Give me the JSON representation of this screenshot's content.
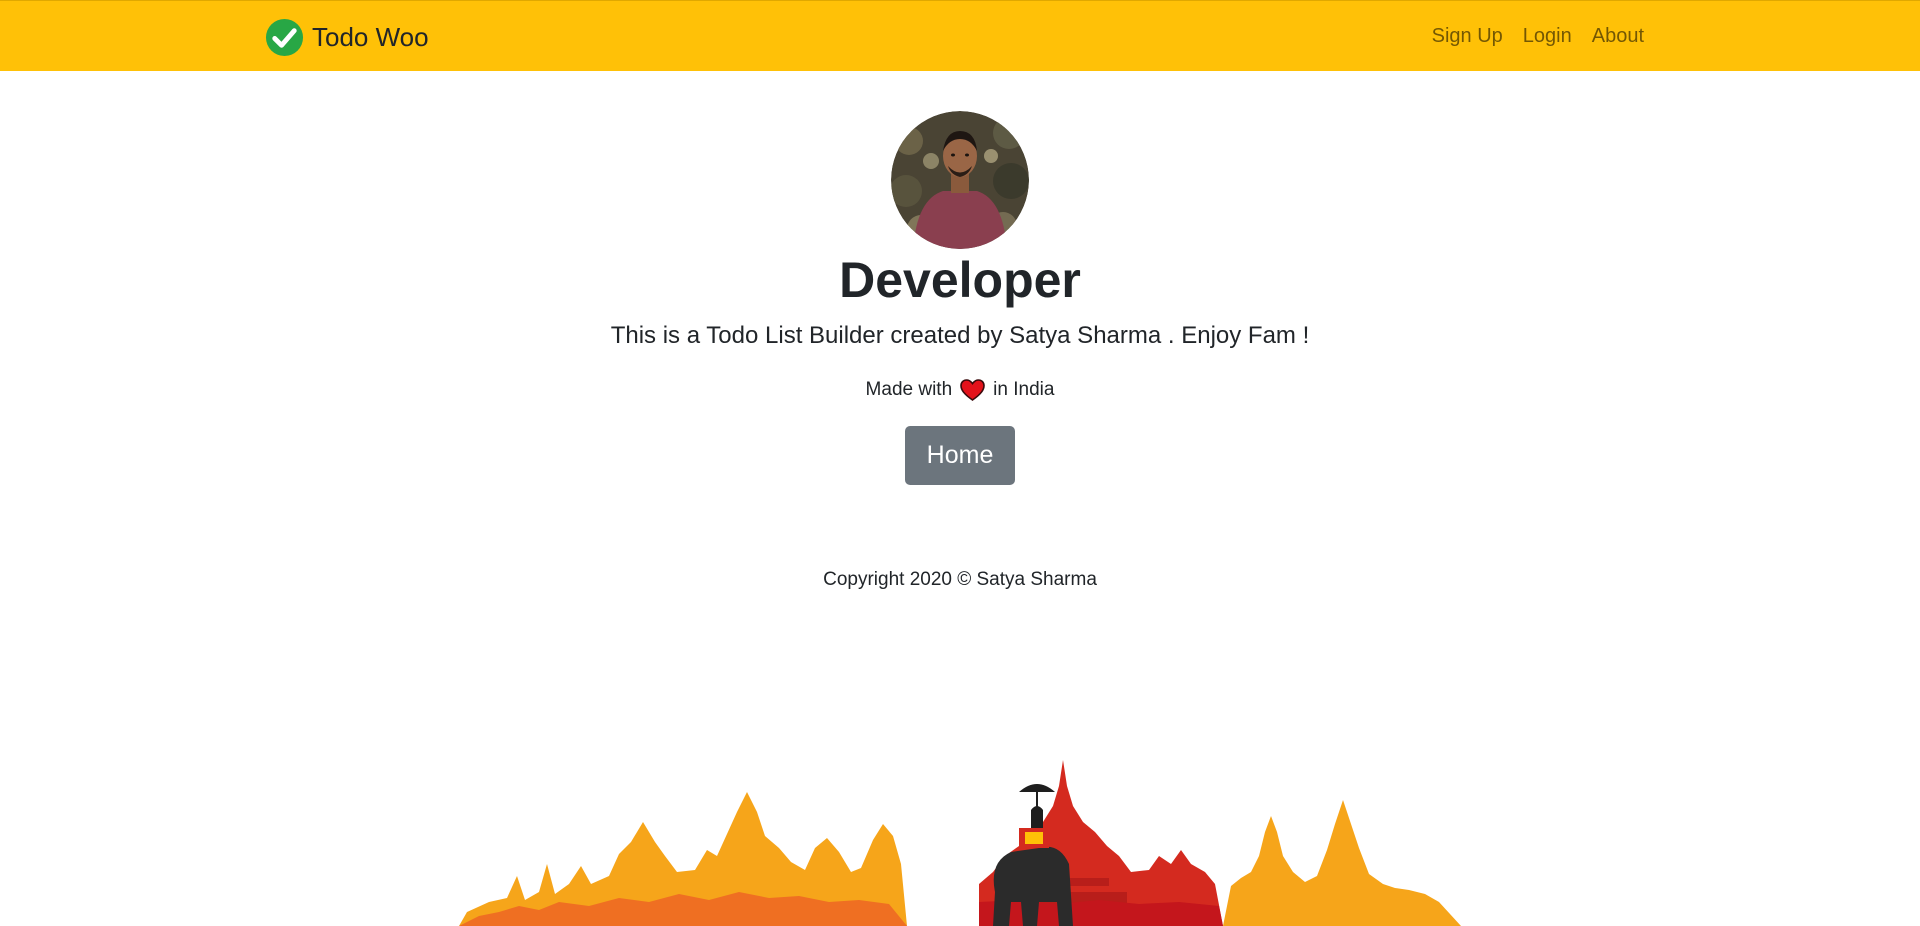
{
  "navbar": {
    "brand": "Todo Woo",
    "brand_icon": "check-circle-icon",
    "links": [
      "Sign Up",
      "Login",
      "About"
    ],
    "background_color": "#ffc107"
  },
  "profile": {
    "avatar": "developer-avatar",
    "title": "Developer",
    "lead": "This is a Todo List Builder created by Satya Sharma . Enjoy Fam !",
    "made_with_prefix": "Made with",
    "made_with_icon": "heart-icon",
    "made_with_suffix": "in India",
    "home_button": "Home"
  },
  "footer": {
    "copyright": "Copyright 2020 © Satya Sharma",
    "illustration": "india-skyline-elephant"
  },
  "colors": {
    "accent": "#ffc107",
    "button": "#6c757d",
    "check": "#28a745",
    "heart": "#e3121b"
  }
}
